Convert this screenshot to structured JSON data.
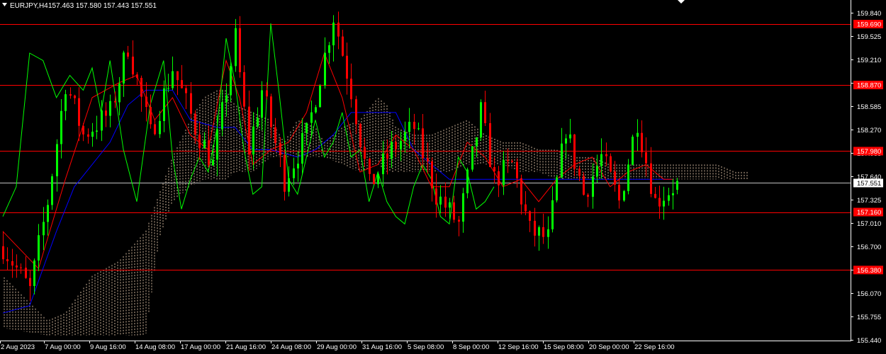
{
  "header": {
    "symbol_timeframe": "EURJPY,H4",
    "ohlc": "157.463 157.580 157.443 157.551"
  },
  "colors": {
    "background": "#000000",
    "bull": "#00ff00",
    "bear": "#ff0000",
    "tenkan": "#ff0000",
    "kijun": "#0000ff",
    "chikou": "#00ff00",
    "cloud": "#f5d6b8",
    "level_line": "#ff0000",
    "price_line": "#c0c0c0",
    "axis_text": "#ffffff"
  },
  "chart_data": {
    "type": "candlestick",
    "title": "EURJPY,H4",
    "ylim": [
      155.44,
      159.9
    ],
    "y_ticks": [
      "159.840",
      "159.525",
      "159.210",
      "158.895",
      "158.585",
      "158.270",
      "157.955",
      "157.640",
      "157.325",
      "157.010",
      "156.700",
      "156.385",
      "156.070",
      "155.755",
      "155.440"
    ],
    "x_ticks": [
      "2 Aug 2023",
      "7 Aug 00:00",
      "9 Aug 16:00",
      "14 Aug 08:00",
      "17 Aug 00:00",
      "21 Aug 16:00",
      "24 Aug 08:00",
      "29 Aug 00:00",
      "31 Aug 16:00",
      "5 Sep 08:00",
      "8 Sep 00:00",
      "12 Sep 16:00",
      "15 Sep 08:00",
      "20 Sep 00:00",
      "22 Sep 16:00"
    ],
    "levels": [
      {
        "label": "159.690",
        "value": 159.69
      },
      {
        "label": "158.870",
        "value": 158.87
      },
      {
        "label": "157.980",
        "value": 157.98
      },
      {
        "label": "157.160",
        "value": 157.16
      },
      {
        "label": "156.380",
        "value": 156.38
      }
    ],
    "current_price": {
      "label": "157.551",
      "value": 157.551
    },
    "close_path": [
      [
        0,
        156.7
      ],
      [
        6,
        156.1
      ],
      [
        10,
        157.3
      ],
      [
        14,
        158.9
      ],
      [
        18,
        158.2
      ],
      [
        24,
        158.5
      ],
      [
        28,
        159.4
      ],
      [
        33,
        158.2
      ],
      [
        38,
        159.1
      ],
      [
        43,
        158.3
      ],
      [
        47,
        157.8
      ],
      [
        52,
        159.5
      ],
      [
        55,
        158.0
      ],
      [
        58,
        158.8
      ],
      [
        63,
        157.6
      ],
      [
        68,
        158.2
      ],
      [
        74,
        159.8
      ],
      [
        78,
        158.8
      ],
      [
        82,
        157.5
      ],
      [
        87,
        158.0
      ],
      [
        92,
        158.3
      ],
      [
        97,
        157.4
      ],
      [
        102,
        157.0
      ],
      [
        107,
        158.5
      ],
      [
        110,
        157.6
      ],
      [
        114,
        157.8
      ],
      [
        118,
        156.9
      ],
      [
        122,
        156.8
      ],
      [
        126,
        158.3
      ],
      [
        130,
        157.4
      ],
      [
        134,
        157.9
      ],
      [
        138,
        157.3
      ],
      [
        142,
        158.4
      ],
      [
        146,
        157.3
      ],
      [
        150,
        157.5
      ]
    ],
    "ichimoku": {
      "tenkan": [
        [
          0,
          156.9
        ],
        [
          8,
          156.4
        ],
        [
          14,
          157.6
        ],
        [
          20,
          158.7
        ],
        [
          26,
          158.9
        ],
        [
          30,
          159.0
        ],
        [
          34,
          158.4
        ],
        [
          38,
          158.7
        ],
        [
          42,
          158.2
        ],
        [
          46,
          158.0
        ],
        [
          50,
          159.2
        ],
        [
          53,
          158.7
        ],
        [
          56,
          157.8
        ],
        [
          60,
          158.0
        ],
        [
          64,
          158.1
        ],
        [
          68,
          158.5
        ],
        [
          72,
          159.3
        ],
        [
          76,
          158.7
        ],
        [
          80,
          157.7
        ],
        [
          84,
          157.8
        ],
        [
          88,
          158.2
        ],
        [
          92,
          158.0
        ],
        [
          96,
          157.5
        ],
        [
          100,
          157.5
        ],
        [
          104,
          158.1
        ],
        [
          108,
          157.9
        ],
        [
          112,
          157.5
        ],
        [
          116,
          157.6
        ],
        [
          120,
          157.3
        ],
        [
          124,
          157.6
        ],
        [
          128,
          157.8
        ],
        [
          132,
          157.9
        ],
        [
          136,
          157.5
        ],
        [
          140,
          157.7
        ],
        [
          144,
          157.8
        ],
        [
          148,
          157.6
        ],
        [
          150,
          157.6
        ]
      ],
      "kijun": [
        [
          0,
          155.8
        ],
        [
          6,
          155.9
        ],
        [
          12,
          156.9
        ],
        [
          16,
          157.5
        ],
        [
          20,
          157.8
        ],
        [
          24,
          158.1
        ],
        [
          28,
          158.6
        ],
        [
          32,
          158.8
        ],
        [
          38,
          158.8
        ],
        [
          42,
          158.4
        ],
        [
          48,
          158.3
        ],
        [
          52,
          158.3
        ],
        [
          56,
          158.0
        ],
        [
          60,
          158.0
        ],
        [
          66,
          157.9
        ],
        [
          70,
          158.0
        ],
        [
          74,
          158.2
        ],
        [
          78,
          158.5
        ],
        [
          84,
          158.5
        ],
        [
          88,
          158.5
        ],
        [
          92,
          158.0
        ],
        [
          96,
          157.8
        ],
        [
          100,
          157.6
        ],
        [
          104,
          157.6
        ],
        [
          110,
          157.6
        ],
        [
          116,
          157.6
        ],
        [
          122,
          157.6
        ],
        [
          128,
          157.6
        ],
        [
          134,
          157.6
        ],
        [
          140,
          157.6
        ],
        [
          146,
          157.6
        ],
        [
          150,
          157.6
        ]
      ],
      "chikou": [
        [
          0,
          157.1
        ],
        [
          3,
          157.5
        ],
        [
          6,
          159.3
        ],
        [
          9,
          159.2
        ],
        [
          12,
          158.7
        ],
        [
          15,
          159.0
        ],
        [
          18,
          158.8
        ],
        [
          20,
          159.1
        ],
        [
          22,
          158.5
        ],
        [
          24,
          159.2
        ],
        [
          27,
          158.0
        ],
        [
          30,
          157.3
        ],
        [
          33,
          158.6
        ],
        [
          36,
          159.2
        ],
        [
          38,
          157.9
        ],
        [
          40,
          157.2
        ],
        [
          42,
          157.6
        ],
        [
          44,
          157.9
        ],
        [
          46,
          157.7
        ],
        [
          48,
          158.3
        ],
        [
          50,
          159.5
        ],
        [
          52,
          158.9
        ],
        [
          54,
          158.0
        ],
        [
          56,
          157.4
        ],
        [
          58,
          157.5
        ],
        [
          60,
          159.7
        ],
        [
          62,
          158.7
        ],
        [
          64,
          157.6
        ],
        [
          66,
          157.4
        ],
        [
          68,
          157.9
        ],
        [
          70,
          158.4
        ],
        [
          72,
          157.9
        ],
        [
          74,
          158.1
        ],
        [
          76,
          158.5
        ],
        [
          78,
          157.9
        ],
        [
          80,
          158.0
        ],
        [
          82,
          157.3
        ],
        [
          84,
          157.7
        ],
        [
          86,
          157.3
        ],
        [
          88,
          157.1
        ],
        [
          90,
          157.0
        ],
        [
          92,
          157.5
        ],
        [
          94,
          157.8
        ],
        [
          96,
          157.6
        ],
        [
          98,
          157.1
        ],
        [
          100,
          157.0
        ],
        [
          102,
          157.9
        ],
        [
          104,
          157.7
        ],
        [
          106,
          157.2
        ],
        [
          108,
          157.3
        ],
        [
          110,
          157.5
        ]
      ],
      "cloud": [
        [
          0,
          155.6,
          156.3
        ],
        [
          10,
          155.5,
          155.7
        ],
        [
          14,
          155.5,
          155.8
        ],
        [
          20,
          155.5,
          156.3
        ],
        [
          26,
          155.5,
          156.5
        ],
        [
          32,
          155.5,
          156.9
        ],
        [
          35,
          156.8,
          157.4
        ],
        [
          38,
          157.3,
          157.9
        ],
        [
          42,
          157.5,
          158.4
        ],
        [
          45,
          157.6,
          158.7
        ],
        [
          48,
          157.6,
          158.8
        ],
        [
          50,
          157.6,
          158.8
        ],
        [
          52,
          157.7,
          158.6
        ],
        [
          56,
          157.7,
          158.5
        ],
        [
          60,
          157.9,
          158.4
        ],
        [
          63,
          157.9,
          158.1
        ],
        [
          66,
          157.9,
          158.4
        ],
        [
          70,
          157.9,
          158.3
        ],
        [
          72,
          157.9,
          158.1
        ],
        [
          76,
          157.8,
          158.3
        ],
        [
          80,
          157.7,
          158.4
        ],
        [
          84,
          157.8,
          158.7
        ],
        [
          86,
          157.7,
          158.6
        ],
        [
          88,
          157.7,
          158.3
        ],
        [
          92,
          157.7,
          158.2
        ],
        [
          96,
          157.7,
          158.2
        ],
        [
          100,
          157.7,
          158.3
        ],
        [
          104,
          157.8,
          158.4
        ],
        [
          108,
          157.8,
          158.2
        ],
        [
          112,
          157.8,
          158.1
        ],
        [
          116,
          157.7,
          158.1
        ],
        [
          120,
          157.7,
          158.0
        ],
        [
          124,
          157.6,
          158.0
        ],
        [
          128,
          157.6,
          157.9
        ],
        [
          132,
          157.6,
          157.9
        ],
        [
          136,
          157.6,
          157.8
        ],
        [
          140,
          157.6,
          157.8
        ],
        [
          144,
          157.6,
          157.8
        ],
        [
          150,
          157.6,
          157.8
        ],
        [
          156,
          157.6,
          157.8
        ],
        [
          160,
          157.6,
          157.8
        ],
        [
          164,
          157.6,
          157.7
        ],
        [
          168,
          157.6,
          157.7
        ],
        [
          172,
          157.6,
          157.7
        ],
        [
          176,
          157.5,
          157.7
        ],
        [
          180,
          157.5,
          157.7
        ]
      ]
    }
  }
}
